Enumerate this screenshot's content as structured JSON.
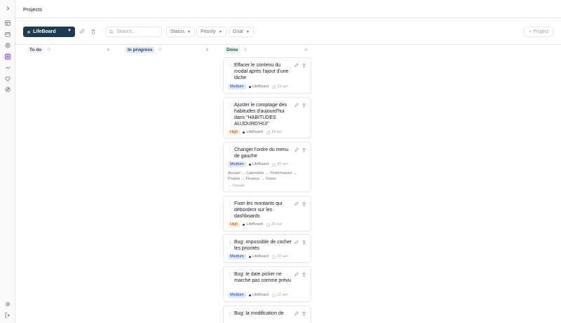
{
  "header": {
    "title": "Projects"
  },
  "sidebar": {
    "items": [
      {
        "icon": "chevron-right-icon"
      },
      {
        "icon": "dashboard-icon"
      },
      {
        "icon": "calendar-icon"
      },
      {
        "icon": "target-icon"
      },
      {
        "icon": "projects-icon",
        "active": true
      },
      {
        "icon": "trending-icon"
      },
      {
        "icon": "heart-icon"
      },
      {
        "icon": "compass-icon"
      },
      {
        "icon": "settings-icon"
      },
      {
        "icon": "logout-icon"
      }
    ]
  },
  "toolbar": {
    "project": "LifeBoard",
    "search_placeholder": "Search...",
    "filters": [
      "Status",
      "Priority",
      "Goal"
    ],
    "new_project": "+ Project"
  },
  "columns": [
    {
      "label": "To do",
      "count": "0",
      "pill_color": "#f3f4f6"
    },
    {
      "label": "In progress",
      "count": "0",
      "pill_color": "#dbeafe"
    },
    {
      "label": "Done",
      "count": "0",
      "pill_color": "#dcfce7"
    }
  ],
  "cards": [
    {
      "title": "Effacer le contenu du modal après l'ajout d'une tâche",
      "priority": "Medium",
      "project": "LifeBoard",
      "date": "19 avr."
    },
    {
      "title": "Ajuster le comptage des habitudes d'aujourd'hui dans \"HABITUDES AUJOURD'HUI\"",
      "priority": "High",
      "project": "LifeBoard",
      "date": "19 avr."
    },
    {
      "title": "Changer l'ordre du menu de gauche",
      "priority": "Medium",
      "project": "LifeBoard",
      "date": "20 avr.",
      "description": "Accueil → Calendrier → Performance → Projets → Finance → Vision",
      "details": "→ Details"
    },
    {
      "title": "Fixer les montants qui débordent sur les dashboards",
      "priority": "High",
      "project": "LifeBoard",
      "date": "20 avr."
    },
    {
      "title": "Bug: impossible de cocher les priorités",
      "priority": "Medium",
      "project": "LifeBoard",
      "date": "22 avr."
    },
    {
      "title": "Bug: le date picker ne marche pas comme prévu",
      "priority": "Medium",
      "project": "LifeBoard",
      "date": "22 avr."
    },
    {
      "title": "Bug: la modification de"
    }
  ]
}
